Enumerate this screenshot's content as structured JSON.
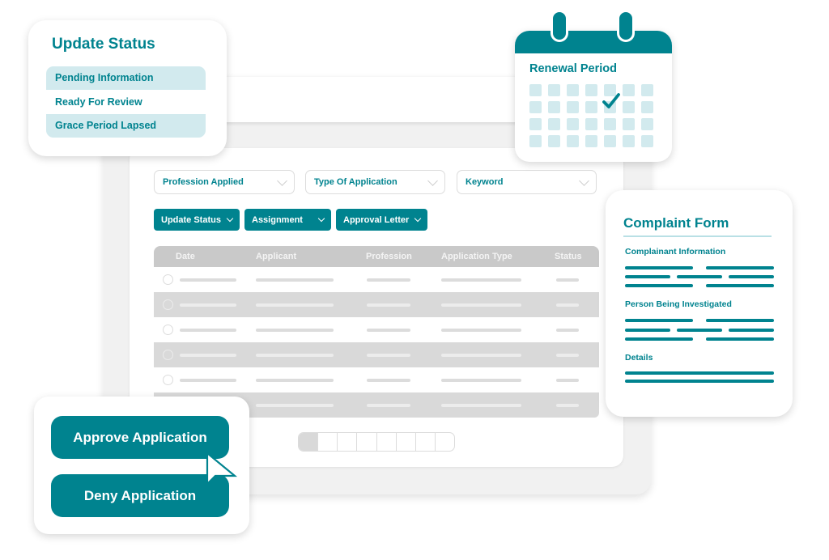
{
  "status_card": {
    "title": "Update Status",
    "items": [
      {
        "label": "Pending Information",
        "highlighted": true
      },
      {
        "label": "Ready For Review",
        "highlighted": false
      },
      {
        "label": "Grace Period Lapsed",
        "highlighted": true
      }
    ]
  },
  "calendar": {
    "title": "Renewal Period",
    "icon": "calendar-icon",
    "checked_cell": {
      "row": 2,
      "col": 5
    },
    "rows": 4,
    "cols": 7
  },
  "filters": [
    {
      "label": "Profession Applied",
      "icon": "chevron-down-icon"
    },
    {
      "label": "Type Of Application",
      "icon": "chevron-down-icon"
    },
    {
      "label": "Keyword",
      "icon": "chevron-down-icon"
    }
  ],
  "actions": [
    {
      "label": "Update Status",
      "icon": "chevron-down-icon"
    },
    {
      "label": "Assignment",
      "icon": "chevron-down-icon"
    },
    {
      "label": "Approval Letter",
      "icon": "chevron-down-icon"
    }
  ],
  "table": {
    "columns": [
      "Date",
      "Applicant",
      "Profession",
      "Application Type",
      "Status"
    ],
    "row_count": 6
  },
  "pagination": {
    "pages": 8,
    "current": 1
  },
  "complaint_form": {
    "title": "Complaint Form",
    "sections": [
      "Complainant Information",
      "Person Being Investigated",
      "Details"
    ]
  },
  "buttons": {
    "approve": "Approve Application",
    "deny": "Deny Application"
  },
  "colors": {
    "accent": "#00838f",
    "highlight": "#d2eaee",
    "table_header": "#c9c9c9",
    "table_alt_row": "#d9d9d9"
  }
}
